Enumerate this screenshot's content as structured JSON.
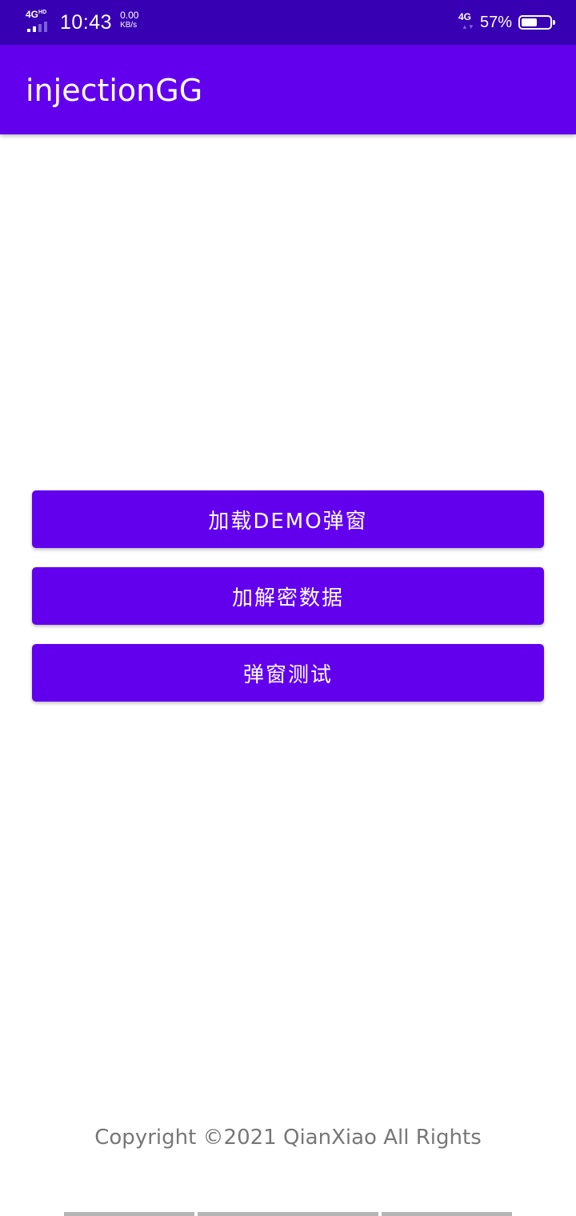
{
  "status_bar": {
    "network_left": "4G",
    "network_left_sup": "HD",
    "time": "10:43",
    "speed_value": "0.00",
    "speed_unit": "KB/s",
    "network_right": "4G",
    "battery_percent": "57%",
    "battery_level": 0.57,
    "background_color": "#3700B3"
  },
  "app_bar": {
    "title": "injectionGG",
    "background_color": "#6200EE"
  },
  "buttons": [
    {
      "label": "加载DEMO弹窗"
    },
    {
      "label": "加解密数据"
    },
    {
      "label": "弹窗测试"
    }
  ],
  "footer": {
    "copyright": "Copyright ©2021 QianXiao All Rights"
  },
  "colors": {
    "primary": "#6200EE",
    "primary_dark": "#3700B3",
    "footer_text": "#777777"
  }
}
